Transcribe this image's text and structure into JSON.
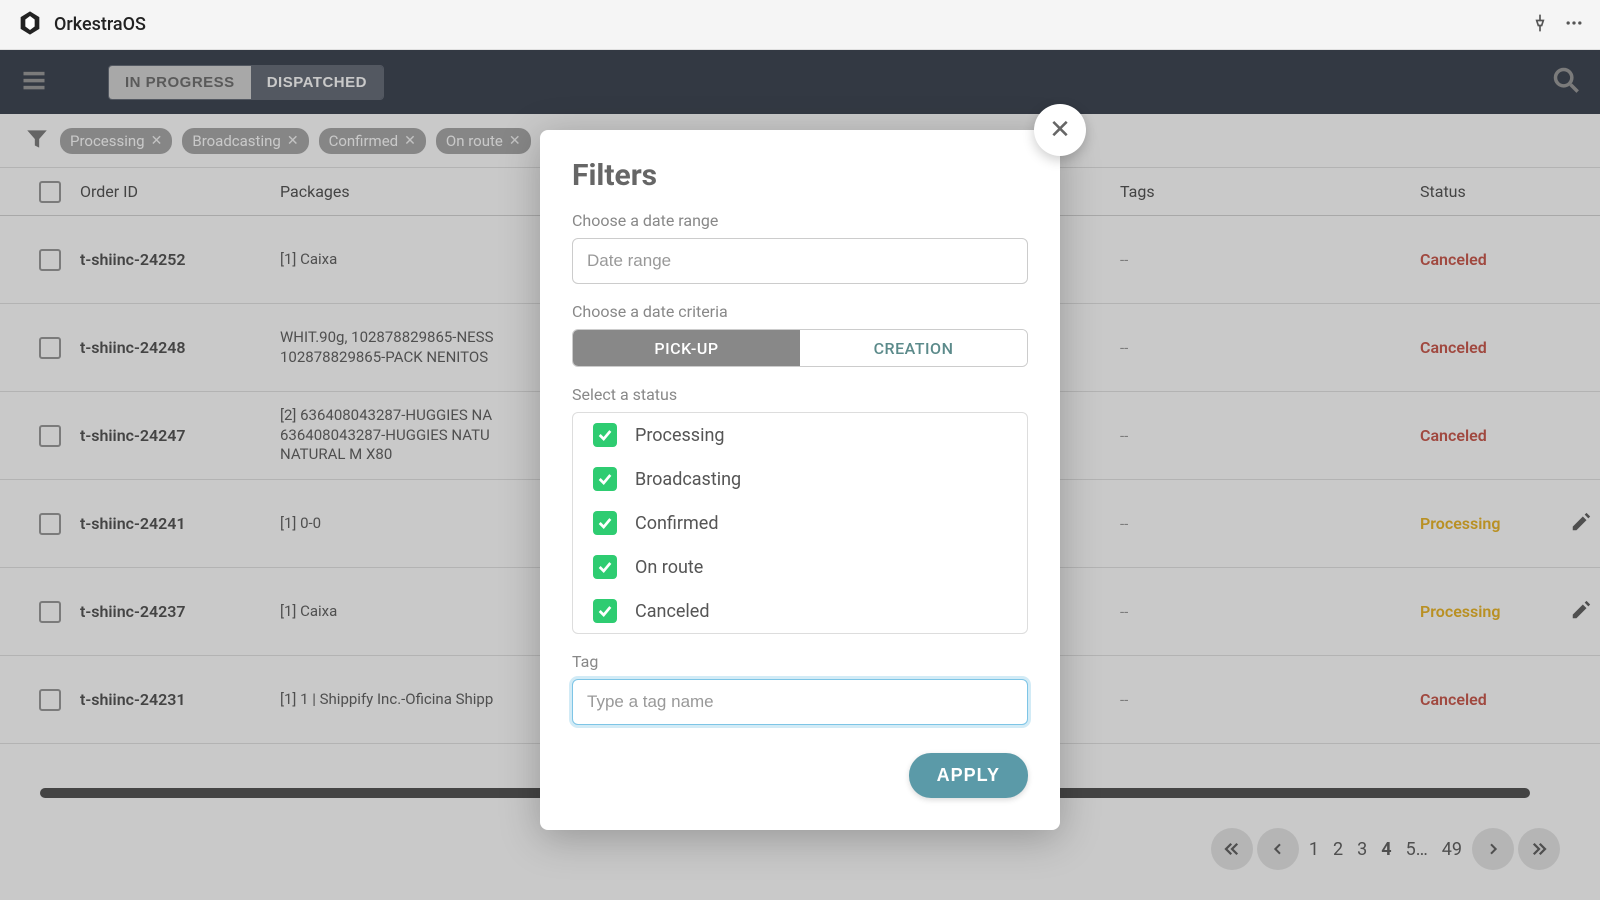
{
  "app": {
    "name": "OrkestraOS"
  },
  "nav": {
    "tabs": [
      {
        "label": "IN PROGRESS",
        "active": false
      },
      {
        "label": "DISPATCHED",
        "active": true
      }
    ]
  },
  "filter_chips": [
    "Processing",
    "Broadcasting",
    "Confirmed",
    "On route"
  ],
  "table": {
    "headers": {
      "order_id": "Order ID",
      "packages": "Packages",
      "tags": "Tags",
      "status": "Status"
    },
    "rows": [
      {
        "order_id": "t-shiinc-24252",
        "packages": "[1] Caixa",
        "tags": "--",
        "status": "Canceled",
        "status_class": "canceled",
        "editable": false
      },
      {
        "order_id": "t-shiinc-24248",
        "packages": "WHIT.90g, 102878829865-NESS\n102878829865-PACK NENITOS",
        "tags": "--",
        "status": "Canceled",
        "status_class": "canceled",
        "editable": false
      },
      {
        "order_id": "t-shiinc-24247",
        "packages": "[2] 636408043287-HUGGIES NA\n636408043287-HUGGIES NATU\nNATURAL M X80",
        "tags": "--",
        "status": "Canceled",
        "status_class": "canceled",
        "editable": false
      },
      {
        "order_id": "t-shiinc-24241",
        "packages": "[1] 0-0",
        "tags": "--",
        "status": "Processing",
        "status_class": "processing",
        "editable": true
      },
      {
        "order_id": "t-shiinc-24237",
        "packages": "[1] Caixa",
        "tags": "--",
        "status": "Processing",
        "status_class": "processing",
        "editable": true
      },
      {
        "order_id": "t-shiinc-24231",
        "packages": "[1] 1 | Shippify Inc.-Oficina Shipp",
        "tags": "--",
        "status": "Canceled",
        "status_class": "canceled",
        "editable": false
      }
    ]
  },
  "pagination": {
    "pages": [
      "1",
      "2",
      "3",
      "4",
      "5…",
      "49"
    ],
    "active": "4"
  },
  "modal": {
    "title": "Filters",
    "date_range_label": "Choose a date range",
    "date_range_placeholder": "Date range",
    "date_criteria_label": "Choose a date criteria",
    "criteria_options": [
      {
        "label": "PICK-UP",
        "active": true
      },
      {
        "label": "CREATION",
        "active": false
      }
    ],
    "status_label": "Select a status",
    "statuses": [
      {
        "label": "Processing",
        "checked": true
      },
      {
        "label": "Broadcasting",
        "checked": true
      },
      {
        "label": "Confirmed",
        "checked": true
      },
      {
        "label": "On route",
        "checked": true
      },
      {
        "label": "Canceled",
        "checked": true
      }
    ],
    "tag_label": "Tag",
    "tag_placeholder": "Type a tag name",
    "apply_label": "APPLY"
  }
}
